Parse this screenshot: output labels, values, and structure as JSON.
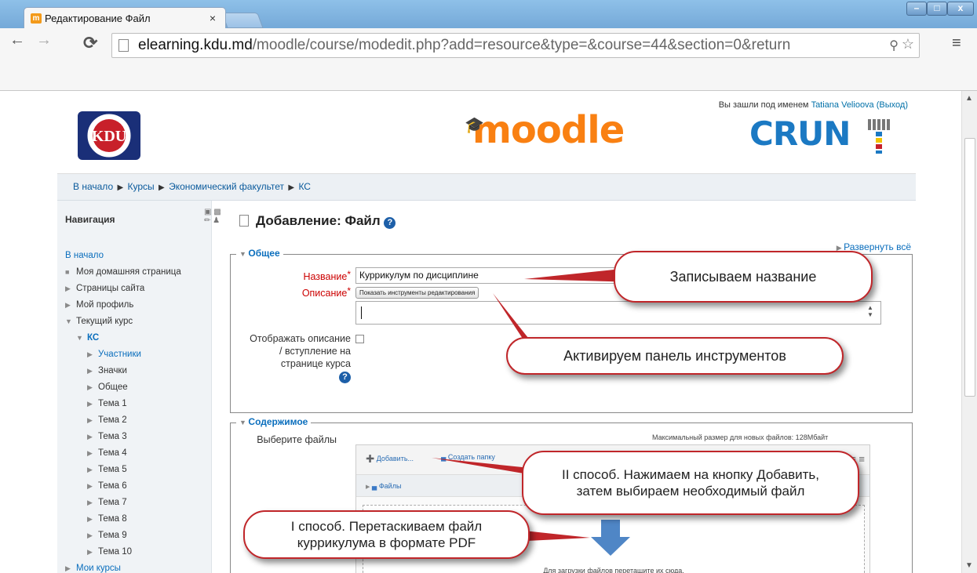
{
  "browser": {
    "tab_title": "Редактирование Файл",
    "tab_close": "×",
    "url_host": "elearning.kdu.md",
    "url_path": "/moodle/course/modedit.php?add=resource&type=&course=44&section=0&return",
    "window_controls": {
      "minimize": "–",
      "maximize": "□",
      "close": "x"
    }
  },
  "header": {
    "moodle_logo": "moodle",
    "login_prefix": "Вы зашли под именем ",
    "login_user": "Tatiana Velioova",
    "logout": "(Выход)",
    "partner_logo": "CRUN",
    "kdu_logo_text": "KDU"
  },
  "breadcrumb": [
    "В начало",
    "Курсы",
    "Экономический факультет",
    "КС"
  ],
  "navigation": {
    "title": "Навигация",
    "items": [
      {
        "label": "В начало",
        "level": 0,
        "link": true,
        "icon": "none"
      },
      {
        "label": "Моя домашняя страница",
        "level": 1,
        "link": false,
        "icon": "bullet"
      },
      {
        "label": "Страницы сайта",
        "level": 1,
        "link": false,
        "icon": "collapsed"
      },
      {
        "label": "Мой профиль",
        "level": 1,
        "link": false,
        "icon": "collapsed"
      },
      {
        "label": "Текущий курс",
        "level": 1,
        "link": false,
        "icon": "expanded"
      },
      {
        "label": "КС",
        "level": 2,
        "link": true,
        "icon": "expanded"
      },
      {
        "label": "Участники",
        "level": 3,
        "link": true,
        "icon": "collapsed"
      },
      {
        "label": "Значки",
        "level": 3,
        "link": false,
        "icon": "collapsed"
      },
      {
        "label": "Общее",
        "level": 3,
        "link": false,
        "icon": "collapsed"
      },
      {
        "label": "Тема 1",
        "level": 3,
        "link": false,
        "icon": "collapsed"
      },
      {
        "label": "Тема 2",
        "level": 3,
        "link": false,
        "icon": "collapsed"
      },
      {
        "label": "Тема 3",
        "level": 3,
        "link": false,
        "icon": "collapsed"
      },
      {
        "label": "Тема 4",
        "level": 3,
        "link": false,
        "icon": "collapsed"
      },
      {
        "label": "Тема 5",
        "level": 3,
        "link": false,
        "icon": "collapsed"
      },
      {
        "label": "Тема 6",
        "level": 3,
        "link": false,
        "icon": "collapsed"
      },
      {
        "label": "Тема 7",
        "level": 3,
        "link": false,
        "icon": "collapsed"
      },
      {
        "label": "Тема 8",
        "level": 3,
        "link": false,
        "icon": "collapsed"
      },
      {
        "label": "Тема 9",
        "level": 3,
        "link": false,
        "icon": "collapsed"
      },
      {
        "label": "Тема 10",
        "level": 3,
        "link": false,
        "icon": "collapsed"
      },
      {
        "label": "Мои курсы",
        "level": 1,
        "link": true,
        "icon": "collapsed"
      }
    ]
  },
  "main": {
    "title": "Добавление: Файл",
    "expand_all": "Развернуть всё",
    "general": {
      "legend": "Общее",
      "name_label": "Название",
      "name_value": "Куррикулум по дисциплине",
      "desc_label": "Описание",
      "editor_toggle": "Показать инструменты редактирования",
      "show_desc_label": "Отображать описание / вступление на странице курса"
    },
    "content": {
      "legend": "Содержимое",
      "select_files_label": "Выберите файлы",
      "max_size": "Максимальный размер для новых файлов: 128Мбайт",
      "add_button": "Добавить...",
      "create_folder_button": "Создать папку",
      "path_label": "Файлы",
      "drop_hint": "Для загрузки файлов перетащите их сюда."
    }
  },
  "callouts": {
    "name": "Записываем название",
    "toolbar": "Активируем панель инструментов",
    "method2": "II способ. Нажимаем на кнопку Добавить, затем выбираем необходимый файл",
    "method1": "I способ. Перетаскиваем файл куррикулума в формате PDF"
  },
  "colors": {
    "callout_border": "#c0262a",
    "link": "#0a6ebd",
    "moodle": "#f98012",
    "crunt": "#1b79c3"
  }
}
